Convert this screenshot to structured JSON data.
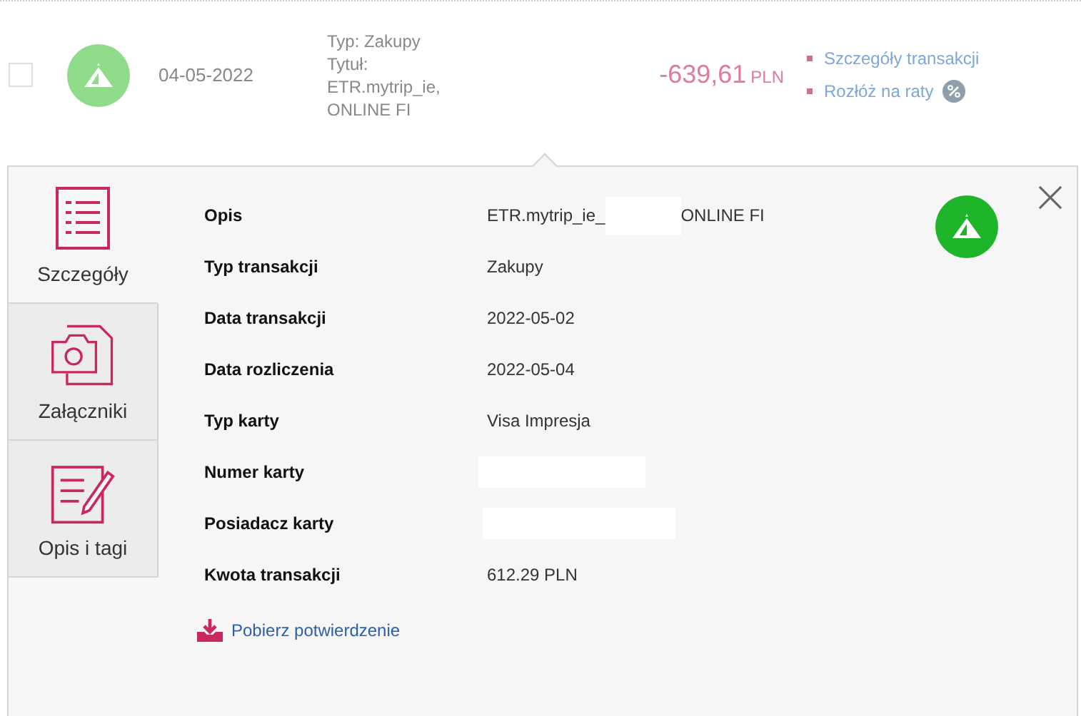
{
  "transaction": {
    "checked": false,
    "date": "04-05-2022",
    "details": [
      "Typ: Zakupy",
      "Tytuł:",
      "ETR.mytrip_ie,",
      "ONLINE FI"
    ],
    "amount": "-639,61",
    "currency": "PLN",
    "links": [
      {
        "label": "Szczegóły transakcji",
        "kind": "plain"
      },
      {
        "label": "Rozłóż na raty",
        "kind": "percent"
      }
    ]
  },
  "tabs": [
    {
      "label": "Szczegóły",
      "kind": "list",
      "selected": true
    },
    {
      "label": "Załączniki",
      "kind": "camera",
      "selected": false
    },
    {
      "label": "Opis i tagi",
      "kind": "note",
      "selected": false
    }
  ],
  "fields": [
    {
      "label": "Opis",
      "value": "ETR.mytrip_ie_",
      "redacted": true,
      "value_after": "ONLINE FI"
    },
    {
      "label": "Typ transakcji",
      "value": "Zakupy",
      "redacted": false
    },
    {
      "label": "Data transakcji",
      "value": "2022-05-02",
      "redacted": false
    },
    {
      "label": "Data rozliczenia",
      "value": "2022-05-04",
      "redacted": false
    },
    {
      "label": "Typ karty",
      "value": "Visa Impresja",
      "redacted": false
    },
    {
      "label": "Numer karty",
      "redacted": true
    },
    {
      "label": "Posiadacz karty",
      "redacted": true
    },
    {
      "label": "Kwota transakcji",
      "value": "612.29 PLN",
      "redacted": false
    }
  ],
  "download_link": "Pobierz potwierdzenie"
}
